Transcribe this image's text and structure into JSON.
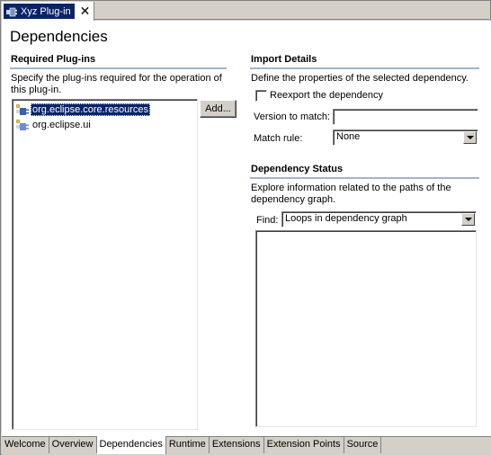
{
  "editor": {
    "tab_title": "Xyz Plug-in",
    "close_glyph": "✕",
    "icon": "plugin-icon"
  },
  "page": {
    "title": "Dependencies"
  },
  "required": {
    "title": "Required Plug-ins",
    "description_line1": "Specify the plug-ins required for the operation of",
    "description_line2": "this plug-in.",
    "items": [
      {
        "label": "org.eclipse.core.resources",
        "selected": true,
        "icon": "plugin-icon"
      },
      {
        "label": "org.eclipse.ui",
        "selected": false,
        "icon": "plugin-icon"
      }
    ],
    "add_label": "Add..."
  },
  "import": {
    "title": "Import Details",
    "description": "Define the properties of the selected dependency.",
    "reexport_label": "Reexport the dependency",
    "reexport_checked": false,
    "version_label": "Version to match:",
    "version_value": "",
    "match_rule_label": "Match rule:",
    "match_rule_value": "None"
  },
  "status": {
    "title": "Dependency Status",
    "description_line1": "Explore information related to the paths of the",
    "description_line2": "dependency graph.",
    "find_label": "Find:",
    "find_value": "Loops in dependency graph"
  },
  "bottom_tabs": [
    {
      "label": "Welcome",
      "active": false
    },
    {
      "label": "Overview",
      "active": false
    },
    {
      "label": "Dependencies",
      "active": true
    },
    {
      "label": "Runtime",
      "active": false
    },
    {
      "label": "Extensions",
      "active": false
    },
    {
      "label": "Extension Points",
      "active": false
    },
    {
      "label": "Source",
      "active": false
    }
  ],
  "colors": {
    "selection": "#0a246a",
    "section_rule": "#a3b4cc",
    "background": "#d4d0c8"
  }
}
